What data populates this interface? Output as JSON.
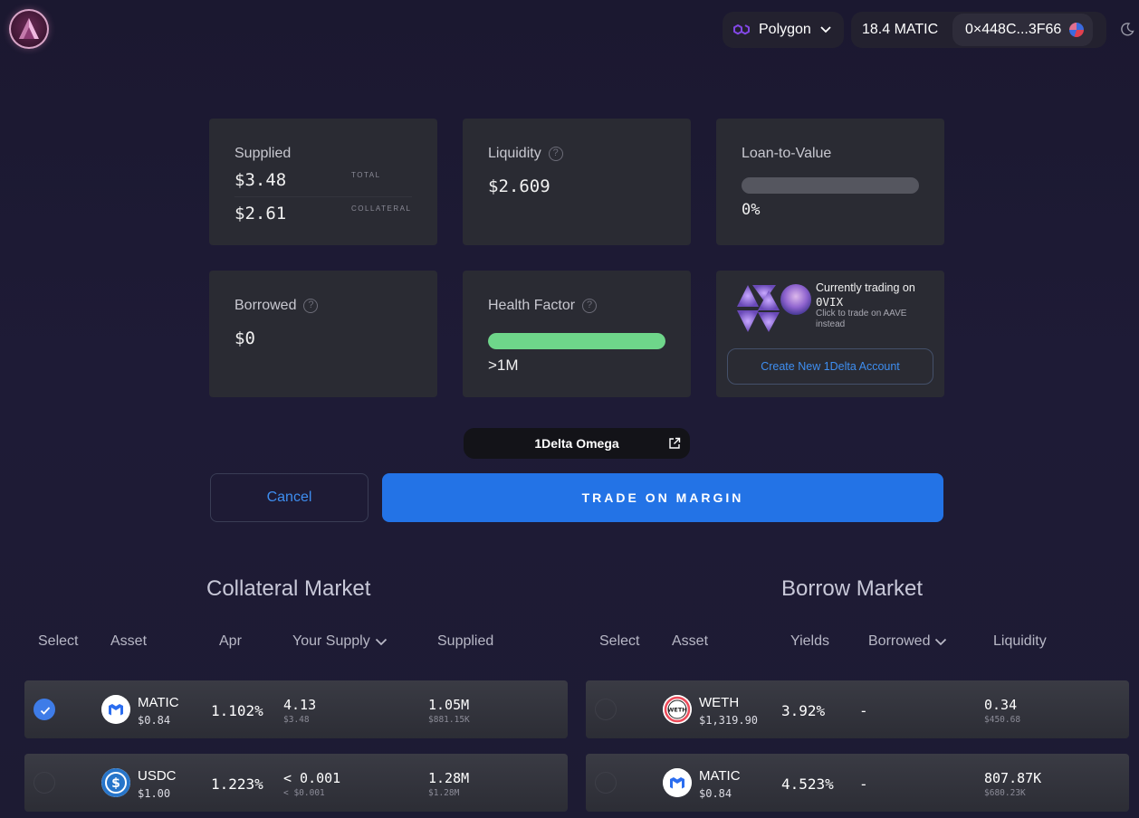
{
  "header": {
    "network": "Polygon",
    "balance": "18.4 MATIC",
    "address": "0×448C...3F66"
  },
  "cards": {
    "supplied": {
      "label": "Supplied",
      "total": "$3.48",
      "total_tag": "TOTAL",
      "collateral": "$2.61",
      "collateral_tag": "COLLATERAL"
    },
    "liquidity": {
      "label": "Liquidity",
      "value": "$2.609"
    },
    "ltv": {
      "label": "Loan-to-Value",
      "value": "0%",
      "fill_fraction": 0.0,
      "bar_color": "#55565f"
    },
    "borrowed": {
      "label": "Borrowed",
      "value": "$0"
    },
    "health": {
      "label": "Health Factor",
      "value": ">1M",
      "fill_fraction": 1.0,
      "bar_color": "#6ed68a"
    },
    "trading": {
      "currently_prefix": "Currently trading on",
      "protocol": "0VIX",
      "switch_hint": "Click to trade on AAVE instead",
      "create_account": "Create New 1Delta Account"
    }
  },
  "account_chip": "1Delta Omega",
  "actions": {
    "cancel": "Cancel",
    "trade": "TRADE ON MARGIN"
  },
  "collateral_market": {
    "title": "Collateral Market",
    "columns": [
      "Select",
      "Asset",
      "Apr",
      "Your Supply",
      "Supplied"
    ],
    "rows": [
      {
        "selected": true,
        "symbol": "MATIC",
        "price": "$0.84",
        "apr": "1.102%",
        "supply": "4.13",
        "supply_usd": "$3.48",
        "supplied": "1.05M",
        "supplied_usd": "$881.15K"
      },
      {
        "selected": false,
        "symbol": "USDC",
        "price": "$1.00",
        "apr": "1.223%",
        "supply": "< 0.001",
        "supply_usd": "< $0.001",
        "supplied": "1.28M",
        "supplied_usd": "$1.28M"
      }
    ]
  },
  "borrow_market": {
    "title": "Borrow Market",
    "columns": [
      "Select",
      "Asset",
      "Yields",
      "Borrowed",
      "Liquidity"
    ],
    "rows": [
      {
        "selected": false,
        "symbol": "WETH",
        "price": "$1,319.90",
        "yield": "3.92%",
        "borrowed": "-",
        "liquidity": "0.34",
        "liquidity_usd": "$450.68"
      },
      {
        "selected": false,
        "symbol": "MATIC",
        "price": "$0.84",
        "yield": "4.523%",
        "borrowed": "-",
        "liquidity": "807.87K",
        "liquidity_usd": "$680.23K"
      }
    ]
  },
  "colors": {
    "accent": "#2373e6",
    "link": "#3e8ef0",
    "card": "#2a2b33",
    "health_bar": "#6ed68a",
    "polygon": "#8247e5"
  },
  "icons": [
    "app-logo-icon",
    "polygon-icon",
    "chevron-down-icon",
    "wallet-avatar-icon",
    "moon-icon",
    "question-icon",
    "external-link-icon",
    "check-icon",
    "matic-token-icon",
    "usdc-token-icon",
    "weth-token-icon"
  ]
}
